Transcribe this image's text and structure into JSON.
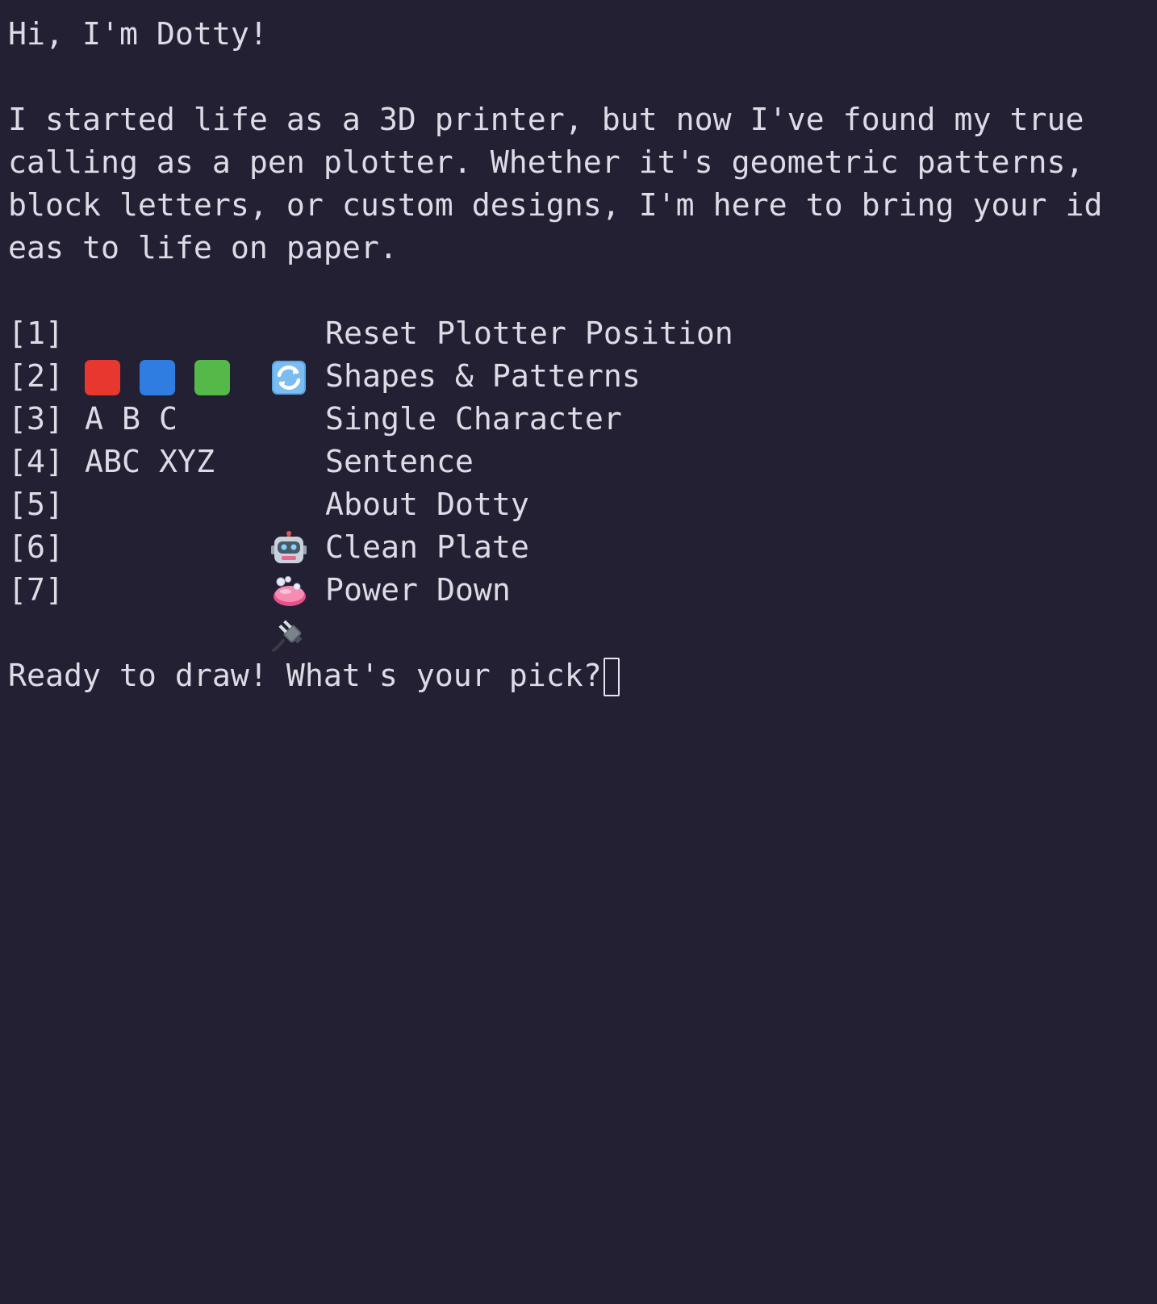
{
  "greeting": "Hi, I'm Dotty!",
  "intro_lines": [
    "I started life as a 3D printer, but now I've found my true",
    "calling as a pen plotter. Whether it's geometric patterns,",
    "block letters, or custom designs, I'm here to bring your id",
    "eas to life on paper."
  ],
  "menu": [
    {
      "key": "[1]",
      "icon": "reset-arrows-icon",
      "icon_text": "",
      "label": "Reset Plotter Position"
    },
    {
      "key": "[2]",
      "icon": "colored-squares-icon",
      "icon_text": "",
      "label": "Shapes & Patterns",
      "colors": [
        "#e8372f",
        "#2f7de0",
        "#54b948"
      ]
    },
    {
      "key": "[3]",
      "icon": "",
      "icon_text": "A B C",
      "label": "Single Character"
    },
    {
      "key": "[4]",
      "icon": "",
      "icon_text": "ABC XYZ",
      "label": "Sentence"
    },
    {
      "key": "[5]",
      "icon": "robot-icon",
      "icon_text": "",
      "label": "About Dotty"
    },
    {
      "key": "[6]",
      "icon": "soap-icon",
      "icon_text": "",
      "label": "Clean Plate"
    },
    {
      "key": "[7]",
      "icon": "plug-icon",
      "icon_text": "",
      "label": "Power Down"
    }
  ],
  "prompt": "Ready to draw! What's your pick?",
  "colors": {
    "background": "#232033",
    "text": "#dedbe7"
  }
}
